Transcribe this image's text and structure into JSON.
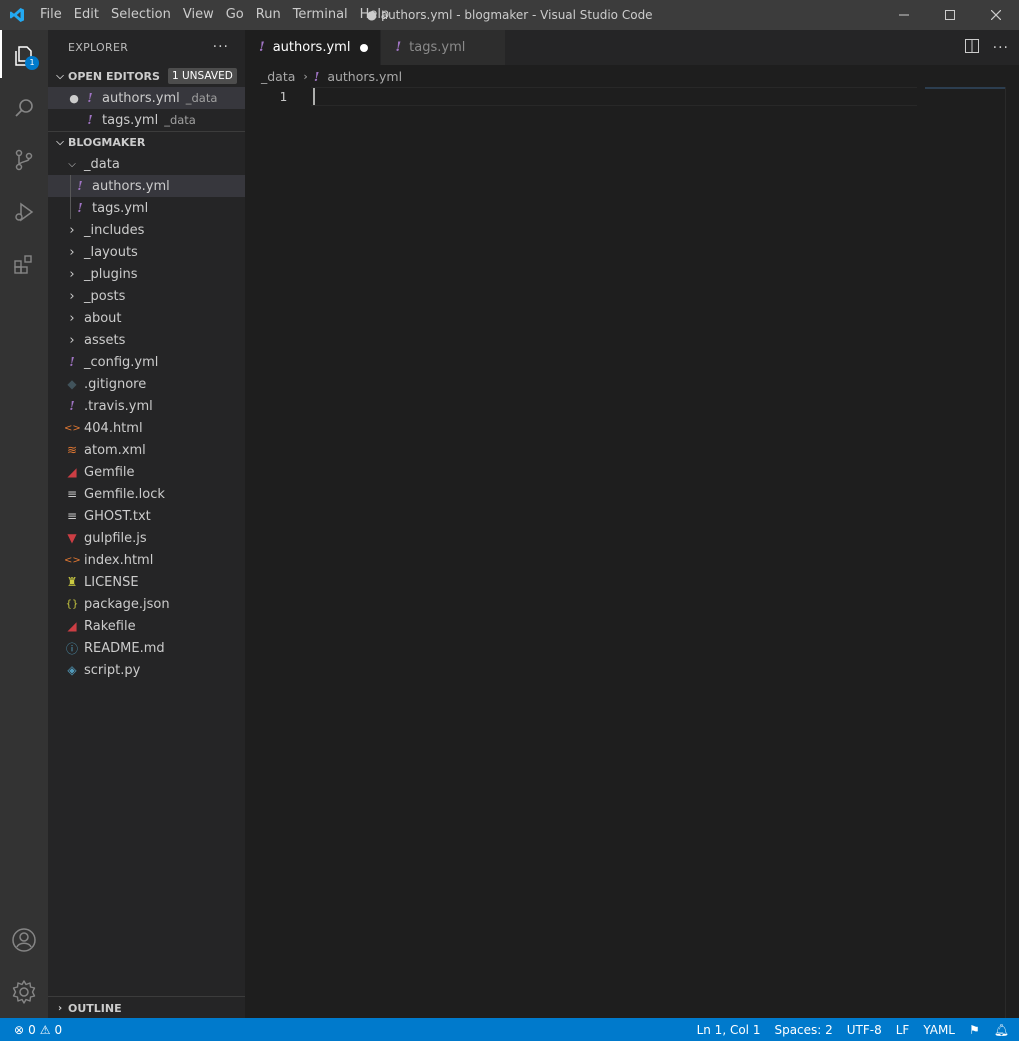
{
  "window": {
    "title": "● authors.yml - blogmaker - Visual Studio Code",
    "menu": [
      "File",
      "Edit",
      "Selection",
      "View",
      "Go",
      "Run",
      "Terminal",
      "Help"
    ]
  },
  "activity": {
    "explorer_badge": "1"
  },
  "sidebar": {
    "title": "EXPLORER",
    "open_editors": {
      "label": "OPEN EDITORS",
      "badge": "1 UNSAVED",
      "items": [
        {
          "name": "authors.yml",
          "desc": "_data"
        },
        {
          "name": "tags.yml",
          "desc": "_data"
        }
      ]
    },
    "project": {
      "label": "BLOGMAKER",
      "data_folder": "_data",
      "data_files": [
        "authors.yml",
        "tags.yml"
      ],
      "folders": [
        "_includes",
        "_layouts",
        "_plugins",
        "_posts",
        "about",
        "assets"
      ],
      "files": [
        {
          "name": "_config.yml",
          "icon": "yaml-icon",
          "glyph": "!",
          "color": "#a074c4"
        },
        {
          "name": ".gitignore",
          "icon": "git-icon",
          "glyph": "◆",
          "color": "#41535b"
        },
        {
          "name": ".travis.yml",
          "icon": "yaml-icon",
          "glyph": "!",
          "color": "#a074c4"
        },
        {
          "name": "404.html",
          "icon": "html-icon",
          "glyph": "<>",
          "color": "#e37933"
        },
        {
          "name": "atom.xml",
          "icon": "rss-icon",
          "glyph": "≋",
          "color": "#e37933"
        },
        {
          "name": "Gemfile",
          "icon": "ruby-icon",
          "glyph": "◢",
          "color": "#cc3e44"
        },
        {
          "name": "Gemfile.lock",
          "icon": "text-icon",
          "glyph": "≡",
          "color": "#cccccc"
        },
        {
          "name": "GHOST.txt",
          "icon": "text-icon",
          "glyph": "≡",
          "color": "#cccccc"
        },
        {
          "name": "gulpfile.js",
          "icon": "gulp-icon",
          "glyph": "▼",
          "color": "#cc3e44"
        },
        {
          "name": "index.html",
          "icon": "html-icon",
          "glyph": "<>",
          "color": "#e37933"
        },
        {
          "name": "LICENSE",
          "icon": "license-icon",
          "glyph": "♜",
          "color": "#cbcb41"
        },
        {
          "name": "package.json",
          "icon": "json-icon",
          "glyph": "{}",
          "color": "#cbcb41"
        },
        {
          "name": "Rakefile",
          "icon": "ruby-icon",
          "glyph": "◢",
          "color": "#cc3e44"
        },
        {
          "name": "README.md",
          "icon": "info-icon",
          "glyph": "ⓘ",
          "color": "#519aba"
        },
        {
          "name": "script.py",
          "icon": "python-icon",
          "glyph": "◈",
          "color": "#519aba"
        }
      ]
    },
    "outline_label": "OUTLINE"
  },
  "tabs": [
    {
      "label": "authors.yml",
      "active": true,
      "dirty": true
    },
    {
      "label": "tags.yml",
      "active": false,
      "dirty": false
    }
  ],
  "breadcrumb": {
    "folder": "_data",
    "file": "authors.yml"
  },
  "editor": {
    "line_number": "1"
  },
  "status": {
    "errors": "0",
    "warnings": "0",
    "position": "Ln 1, Col 1",
    "spaces": "Spaces: 2",
    "encoding": "UTF-8",
    "eol": "LF",
    "language": "YAML"
  },
  "colors": {
    "accent": "#007acc",
    "yaml": "#a074c4"
  }
}
